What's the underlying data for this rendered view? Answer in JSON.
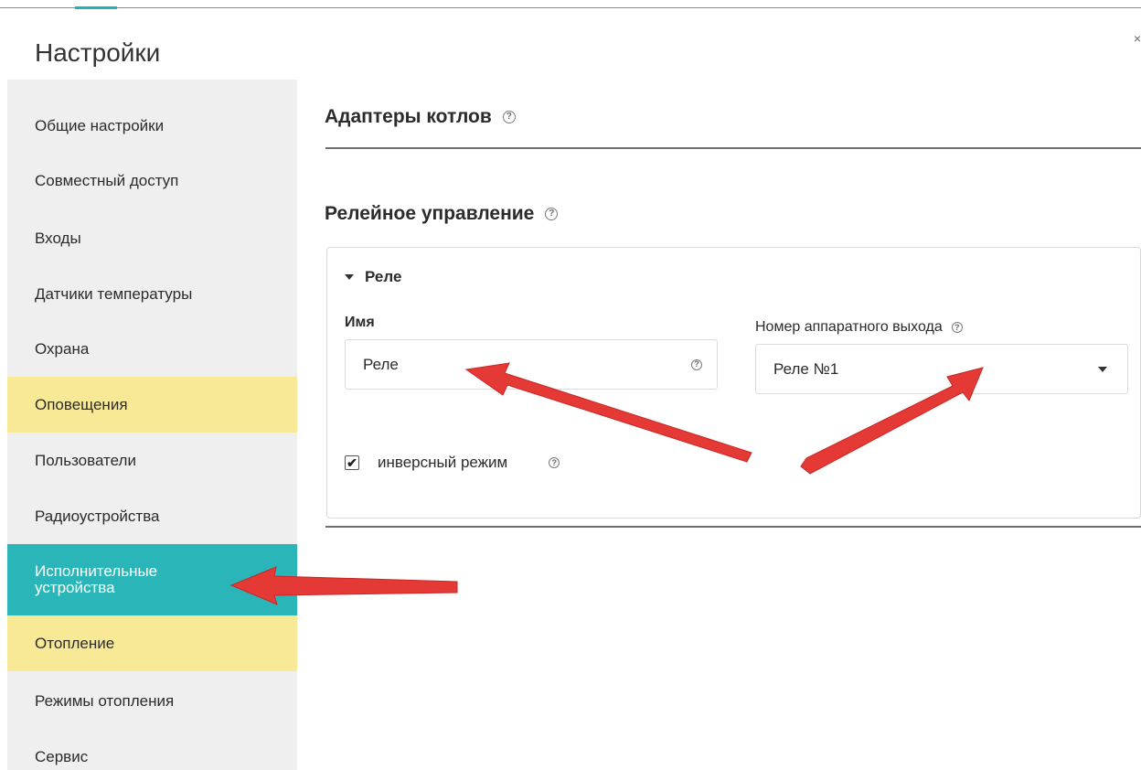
{
  "header": {
    "title": "Настройки"
  },
  "sidebar": {
    "items": [
      {
        "label": "Общие настройки",
        "state": "normal"
      },
      {
        "label": "Совместный доступ",
        "state": "normal"
      },
      {
        "label": "Входы",
        "state": "normal"
      },
      {
        "label": "Датчики температуры",
        "state": "normal"
      },
      {
        "label": "Охрана",
        "state": "normal"
      },
      {
        "label": "Оповещения",
        "state": "highlight"
      },
      {
        "label": "Пользователи",
        "state": "normal"
      },
      {
        "label": "Радиоустройства",
        "state": "normal"
      },
      {
        "label": "Исполнительные\nустройства",
        "state": "active"
      },
      {
        "label": "Отопление",
        "state": "highlight"
      },
      {
        "label": "Режимы отопления",
        "state": "normal"
      },
      {
        "label": "Сервис",
        "state": "normal"
      }
    ]
  },
  "main": {
    "boiler_adapters_title": "Адаптеры котлов",
    "relay_control_title": "Релейное управление",
    "relay_card": {
      "header": "Реле",
      "name_label": "Имя",
      "name_value": "Реле",
      "output_label": "Номер аппаратного выхода",
      "output_value": "Реле №1",
      "inverse_label": "инверсный режим",
      "inverse_checked": true
    }
  },
  "icons": {
    "help": "?",
    "check": "✔"
  },
  "colors": {
    "active_item": "#2ab6b8",
    "highlight_item": "#f7e996",
    "sidebar_bg": "#efefef",
    "annotation_arrow": "#e53935"
  }
}
